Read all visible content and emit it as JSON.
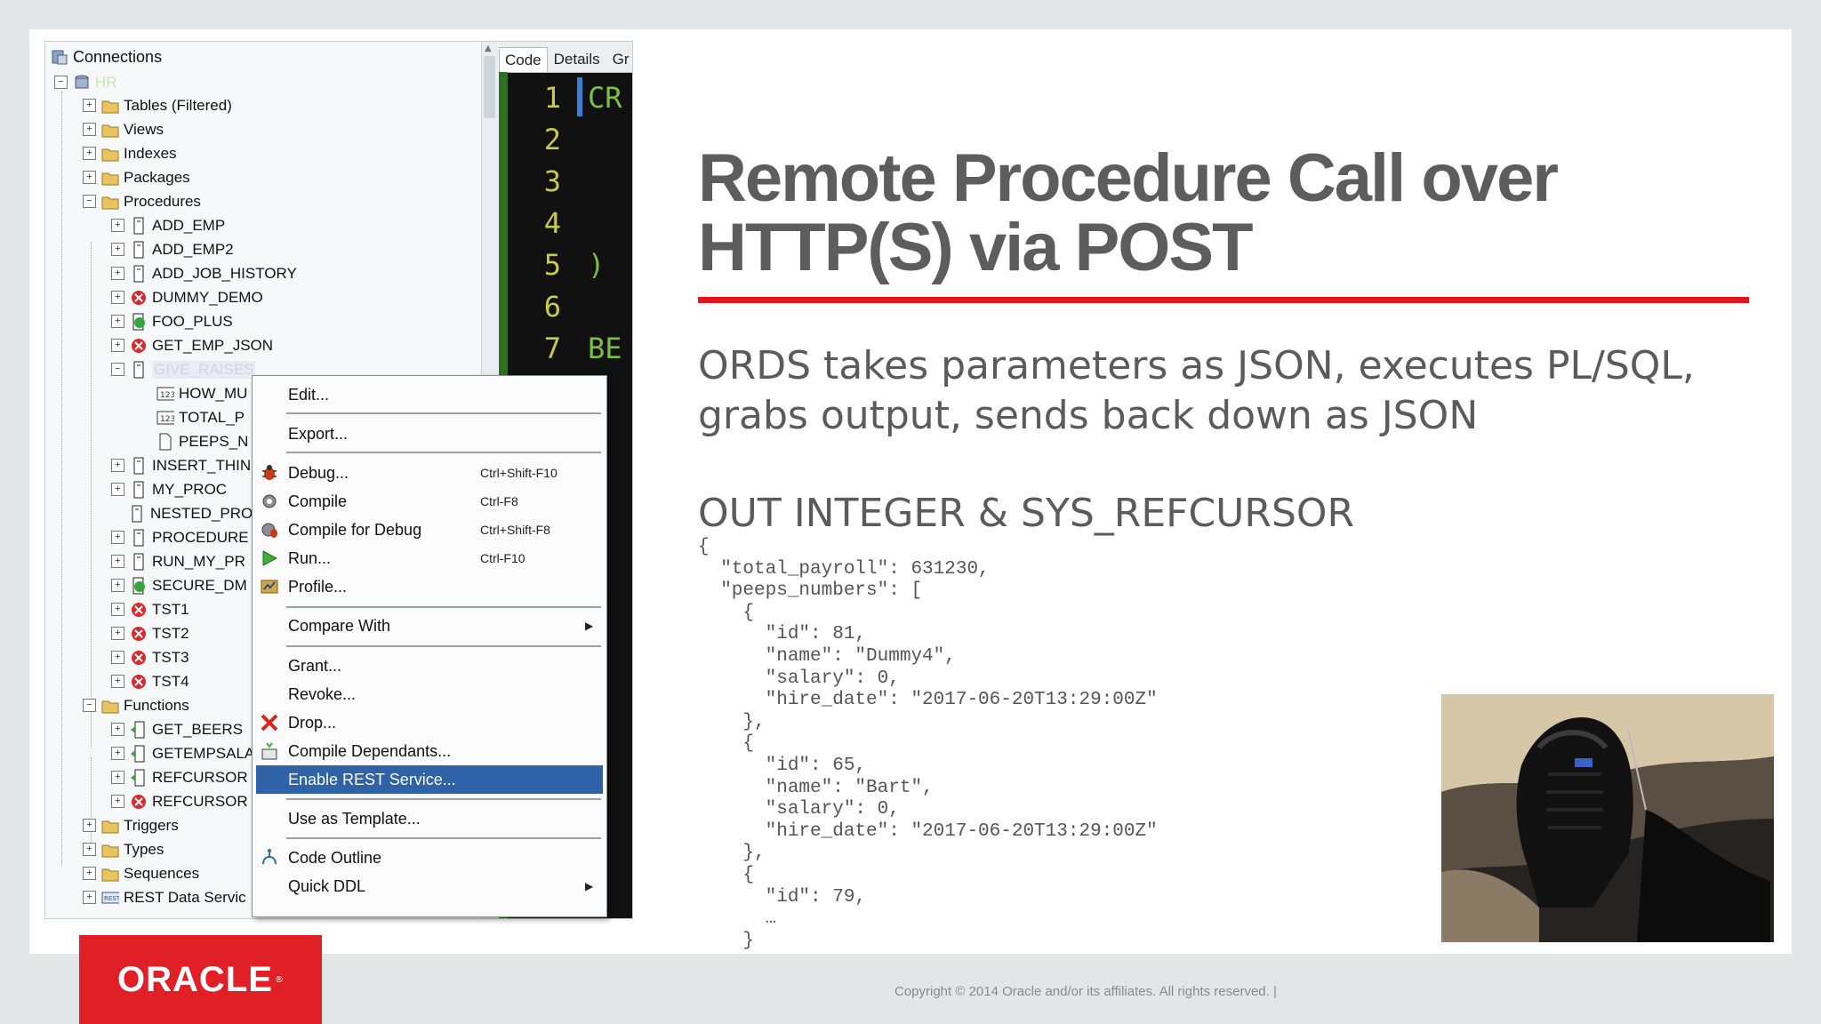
{
  "ide": {
    "tree_title": "Connections",
    "tree": {
      "connection": "HR",
      "tables": "Tables (Filtered)",
      "views": "Views",
      "indexes": "Indexes",
      "packages": "Packages",
      "procedures": "Procedures",
      "proc_items": [
        "ADD_EMP",
        "ADD_EMP2",
        "ADD_JOB_HISTORY",
        "DUMMY_DEMO",
        "FOO_PLUS",
        "GET_EMP_JSON",
        "GIVE_RAISES"
      ],
      "params": [
        "HOW_MU",
        "TOTAL_P",
        "PEEPS_N"
      ],
      "proc_items2": [
        "INSERT_THIN",
        "MY_PROC",
        "NESTED_PRO",
        "PROCEDURE",
        "RUN_MY_PR",
        "SECURE_DM",
        "TST1",
        "TST2",
        "TST3",
        "TST4"
      ],
      "functions": "Functions",
      "func_items": [
        "GET_BEERS",
        "GETEMPSALA",
        "REFCURSOR",
        "REFCURSOR"
      ],
      "triggers": "Triggers",
      "types": "Types",
      "sequences": "Sequences",
      "rest": "REST Data Servic"
    },
    "code_tabs": [
      "Code",
      "Details",
      "Gr"
    ],
    "line_numbers": [
      "1",
      "2",
      "3",
      "4",
      "5",
      "6",
      "7"
    ],
    "code_lines": [
      "CR",
      "",
      "",
      "",
      ")",
      "",
      "BE"
    ],
    "menu": {
      "edit": "Edit...",
      "export": "Export...",
      "debug": "Debug...",
      "debug_sc": "Ctrl+Shift-F10",
      "compile": "Compile",
      "compile_sc": "Ctrl-F8",
      "compile_debug": "Compile for Debug",
      "compile_debug_sc": "Ctrl+Shift-F8",
      "run": "Run...",
      "run_sc": "Ctrl-F10",
      "profile": "Profile...",
      "compare": "Compare With",
      "grant": "Grant...",
      "revoke": "Revoke...",
      "drop": "Drop...",
      "compile_dep": "Compile Dependants...",
      "enable_rest": "Enable REST Service...",
      "use_template": "Use as Template...",
      "code_outline": "Code Outline",
      "quick_ddl": "Quick DDL"
    }
  },
  "slide": {
    "title": "Remote Procedure Call over HTTP(S) via POST",
    "subtitle": "ORDS takes parameters as JSON, executes PL/SQL, grabs output, sends back down as JSON",
    "heading2": "OUT INTEGER & SYS_REFCURSOR",
    "json_sample": "{\n  \"total_payroll\": 631230,\n  \"peeps_numbers\": [\n    {\n      \"id\": 81,\n      \"name\": \"Dummy4\",\n      \"salary\": 0,\n      \"hire_date\": \"2017-06-20T13:29:00Z\"\n    },\n    {\n      \"id\": 65,\n      \"name\": \"Bart\",\n      \"salary\": 0,\n      \"hire_date\": \"2017-06-20T13:29:00Z\"\n    },\n    {\n      \"id\": 79,\n      …\n    }",
    "logo_text": "ORACLE",
    "copyright": "Copyright © 2014 Oracle and/or its affiliates. All rights reserved.  |"
  },
  "colors": {
    "accent_red": "#e2141c",
    "menu_highlight": "#2f62a6",
    "title_gray": "#5d5d5d"
  }
}
